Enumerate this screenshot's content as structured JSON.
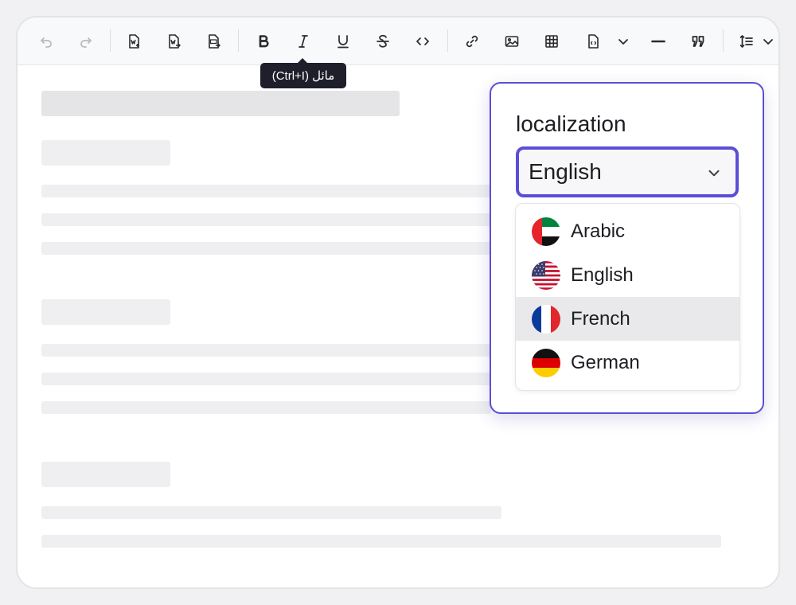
{
  "tooltip": {
    "text": "مائل (Ctrl+I)"
  },
  "toolbar": {
    "buttons": [
      "undo-icon",
      "redo-icon",
      "import-word-icon",
      "export-word-icon",
      "export-pdf-icon",
      "bold-icon",
      "italic-icon",
      "underline-icon",
      "strikethrough-icon",
      "code-icon",
      "link-icon",
      "image-icon",
      "table-icon",
      "insert-template-icon",
      "chevron-down-icon",
      "horizontal-rule-icon",
      "blockquote-icon",
      "line-height-icon",
      "chevron-down-icon"
    ]
  },
  "localization": {
    "label": "localization",
    "selected": "English",
    "options": [
      {
        "label": "Arabic",
        "flag": "uae-flag-icon"
      },
      {
        "label": "English",
        "flag": "usa-flag-icon"
      },
      {
        "label": "French",
        "flag": "france-flag-icon",
        "hovered": true
      },
      {
        "label": "German",
        "flag": "germany-flag-icon"
      }
    ]
  },
  "colors": {
    "accent": "#5b4ed6",
    "tooltip_bg": "#1e1f2b",
    "hover_bg": "#e9e9ec",
    "skeleton": "#efeff1"
  }
}
